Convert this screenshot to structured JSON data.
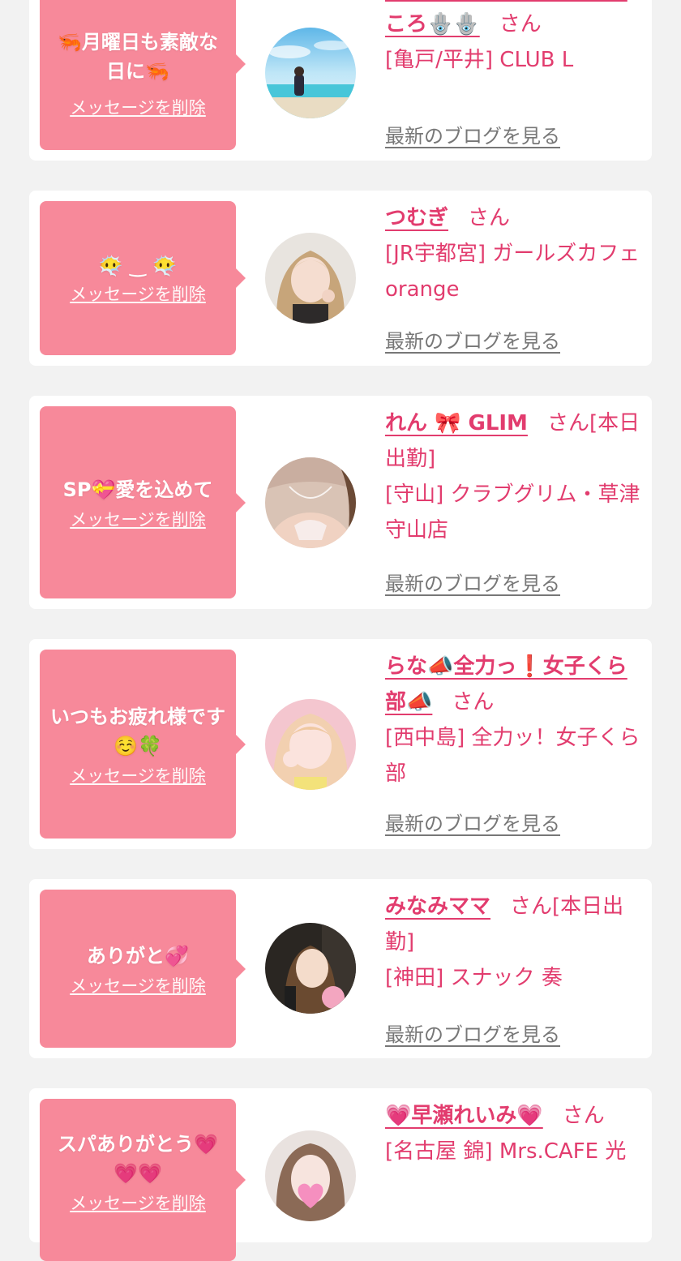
{
  "delete_label": "メッセージを削除",
  "blog_label": "最新のブログを見る",
  "san_suffix": "さん",
  "colors": {
    "bubble": "#f7899a",
    "accent": "#e23c6e",
    "link_gray": "#777777",
    "background": "#f2f2f2"
  },
  "cards": [
    {
      "message": "🦐月曜日も素敵な日に🦐",
      "name": "🪬🪬平井CLUB L▷·)ﾉこころ🪬🪬",
      "name_suffix": "",
      "shop": "[亀戸/平井] CLUB L"
    },
    {
      "message": "😶‍🌫️ ‿ 😶‍🌫️",
      "name": "つむぎ",
      "name_suffix": "",
      "shop": "[JR宇都宮] ガールズカフェ orange"
    },
    {
      "message": "SP💝愛を込めて",
      "name": "れん 🎀 GLIM",
      "name_suffix": "[本日出勤]",
      "shop": "[守山] クラブグリム・草津守山店"
    },
    {
      "message": "いつもお疲れ様です☺️🍀",
      "name": "らな📣全力っ❗️女子くら部📣",
      "name_suffix": "",
      "shop": "[西中島] 全力ッ！女子くら部"
    },
    {
      "message": "ありがと💞",
      "name": "みなみママ",
      "name_suffix": "[本日出勤]",
      "shop": "[神田] スナック 奏"
    },
    {
      "message": "スパありがとう💗💗💗",
      "name": "💗早瀬れいみ💗",
      "name_suffix": "",
      "shop": "[名古屋 錦] Mrs.CAFE 光"
    }
  ]
}
